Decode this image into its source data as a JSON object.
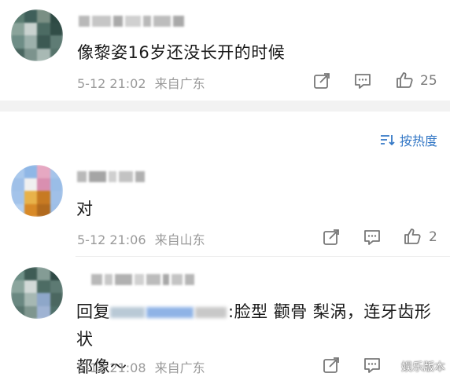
{
  "comments": [
    {
      "text": "像黎姿16岁还没长开的时候",
      "time": "5-12 21:02",
      "location": "来自广东",
      "likes": "25"
    },
    {
      "text": "对",
      "time": "5-12 21:06",
      "location": "来自山东",
      "likes": "2"
    },
    {
      "reply_prefix": "回复",
      "text_after": ":脸型 颧骨 梨涡，连牙齿形状",
      "text_line2": "都像～",
      "time": "5-12 21:08",
      "location": "来自广东"
    }
  ],
  "sort_label": "按热度",
  "watermark": "娱乐版本",
  "icons": [
    "share-icon",
    "comment-icon",
    "like-icon",
    "sort-icon"
  ],
  "colors": {
    "accent": "#3478c6",
    "meta": "#9a9a9a",
    "separator": "#f2f2f2"
  }
}
